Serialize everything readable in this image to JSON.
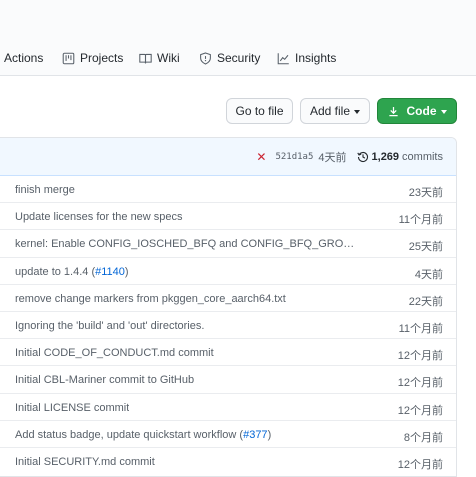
{
  "repo_nav": {
    "items": [
      {
        "label": "Actions",
        "icon": "play-icon"
      },
      {
        "label": "Projects",
        "icon": "project-icon"
      },
      {
        "label": "Wiki",
        "icon": "book-icon"
      },
      {
        "label": "Security",
        "icon": "shield-icon"
      },
      {
        "label": "Insights",
        "icon": "graph-icon"
      }
    ]
  },
  "toolbar": {
    "goto_file": "Go to file",
    "add_file": "Add file",
    "code": "Code"
  },
  "latest_commit": {
    "status_icon": "x-icon",
    "status_color": "#cb2431",
    "sha": "521d1a5",
    "age": "4天前",
    "commit_count": "1,269",
    "commits_label": "commits"
  },
  "files": [
    {
      "message": "finish merge",
      "link": "",
      "suffix": "",
      "age": "23天前"
    },
    {
      "message": "Update licenses for the new specs",
      "link": "",
      "suffix": "",
      "age": "11个月前"
    },
    {
      "message": "kernel: Enable CONFIG_IOSCHED_BFQ and CONFIG_BFQ_GROUP_IOSCHE...",
      "link": "",
      "suffix": "",
      "age": "25天前"
    },
    {
      "message": "update to 1.4.4 (",
      "link": "#1140",
      "suffix": ")",
      "age": "4天前"
    },
    {
      "message": "remove change markers from pkggen_core_aarch64.txt",
      "link": "",
      "suffix": "",
      "age": "22天前"
    },
    {
      "message": "Ignoring the 'build' and 'out' directories.",
      "link": "",
      "suffix": "",
      "age": "11个月前"
    },
    {
      "message": "Initial CODE_OF_CONDUCT.md commit",
      "link": "",
      "suffix": "",
      "age": "12个月前"
    },
    {
      "message": "Initial CBL-Mariner commit to GitHub",
      "link": "",
      "suffix": "",
      "age": "12个月前"
    },
    {
      "message": "Initial LICENSE commit",
      "link": "",
      "suffix": "",
      "age": "12个月前"
    },
    {
      "message": "Add status badge, update quickstart workflow (",
      "link": "#377",
      "suffix": ")",
      "age": "8个月前"
    },
    {
      "message": "Initial SECURITY.md commit",
      "link": "",
      "suffix": "",
      "age": "12个月前"
    }
  ],
  "colors": {
    "accent_green": "#2ea44f",
    "link_blue": "#0366d6",
    "header_blue": "#f1f8ff"
  }
}
